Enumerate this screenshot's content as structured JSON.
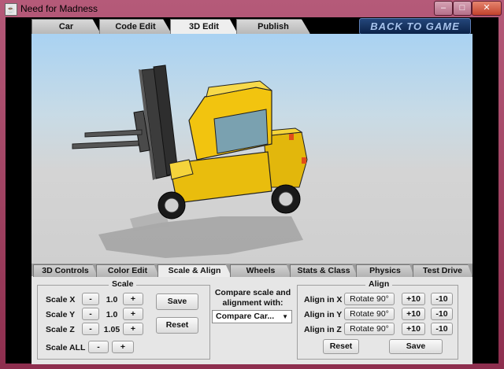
{
  "window": {
    "title": "Need for Madness",
    "controls": {
      "minimize": "–",
      "maximize": "□",
      "close": "✕"
    }
  },
  "top_tabs": [
    {
      "label": "Car",
      "active": false
    },
    {
      "label": "Code Edit",
      "active": false
    },
    {
      "label": "3D Edit",
      "active": true
    },
    {
      "label": "Publish",
      "active": false
    }
  ],
  "back_button": "BACK TO GAME",
  "bottom_tabs": [
    {
      "label": "3D Controls",
      "active": false
    },
    {
      "label": "Color Edit",
      "active": false
    },
    {
      "label": "Scale & Align",
      "active": true
    },
    {
      "label": "Wheels",
      "active": false
    },
    {
      "label": "Stats & Class",
      "active": false
    },
    {
      "label": "Physics",
      "active": false
    },
    {
      "label": "Test Drive",
      "active": false
    }
  ],
  "scale": {
    "title": "Scale",
    "rows": [
      {
        "label": "Scale X",
        "minus": "-",
        "value": "1.0",
        "plus": "+"
      },
      {
        "label": "Scale Y",
        "minus": "-",
        "value": "1.0",
        "plus": "+"
      },
      {
        "label": "Scale Z",
        "minus": "-",
        "value": "1.05",
        "plus": "+"
      }
    ],
    "all": {
      "label": "Scale ALL",
      "minus": "-",
      "plus": "+"
    },
    "save": "Save",
    "reset": "Reset"
  },
  "compare": {
    "label_line1": "Compare scale and",
    "label_line2": "alignment with:",
    "selected": "Compare Car..."
  },
  "align": {
    "title": "Align",
    "rows": [
      {
        "label": "Align in X",
        "rotate": "Rotate 90°",
        "plus": "+10",
        "minus": "-10"
      },
      {
        "label": "Align in Y",
        "rotate": "Rotate 90°",
        "plus": "+10",
        "minus": "-10"
      },
      {
        "label": "Align in Z",
        "rotate": "Rotate 90°",
        "plus": "+10",
        "minus": "-10"
      }
    ],
    "reset": "Reset",
    "save": "Save"
  },
  "colors": {
    "window_frame": "#8d2e4e",
    "back_button_bg": "#0b2248",
    "vehicle_body": "#f2c40f",
    "sky": "#a9d2f2",
    "ground": "#cfcfcf"
  }
}
